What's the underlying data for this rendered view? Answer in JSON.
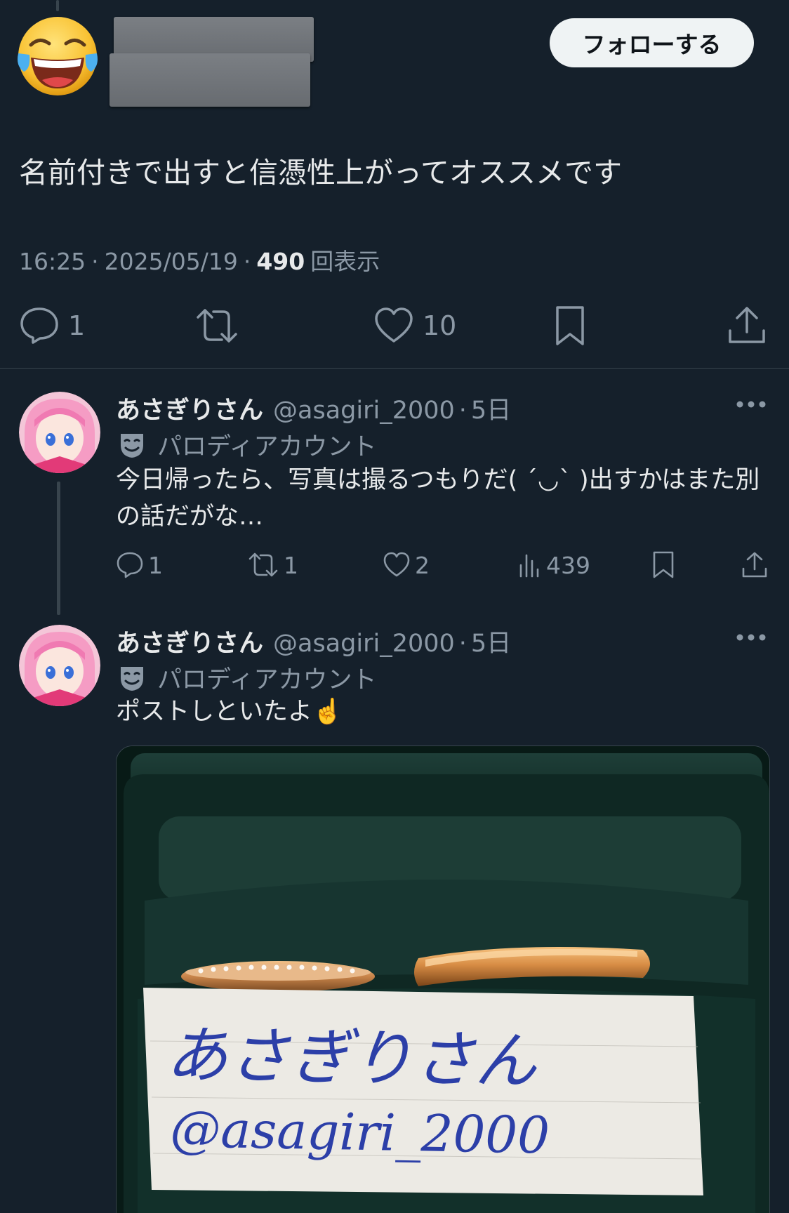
{
  "main_post": {
    "follow_label": "フォローする",
    "text": "名前付きで出すと信憑性上がってオススメです",
    "time": "16:25",
    "date": "2025/05/19",
    "views_count": "490",
    "views_label": "回表示",
    "reply_count": "1",
    "like_count": "10"
  },
  "replies": [
    {
      "name": "あさぎりさん",
      "handle": "@asagiri_2000",
      "time": "5日",
      "badge": "パロディアカウント",
      "text": "今日帰ったら、写真は撮るつもりだ( ´◡` )出すかはまた別の話だがな…",
      "reply_count": "1",
      "repost_count": "1",
      "like_count": "2",
      "view_count": "439"
    },
    {
      "name": "あさぎりさん",
      "handle": "@asagiri_2000",
      "time": "5日",
      "badge": "パロディアカウント",
      "text": "ポストしといたよ☝️",
      "photo": {
        "note_line1": "あさぎりさん",
        "note_line2": "@asagiri_2000"
      }
    }
  ]
}
